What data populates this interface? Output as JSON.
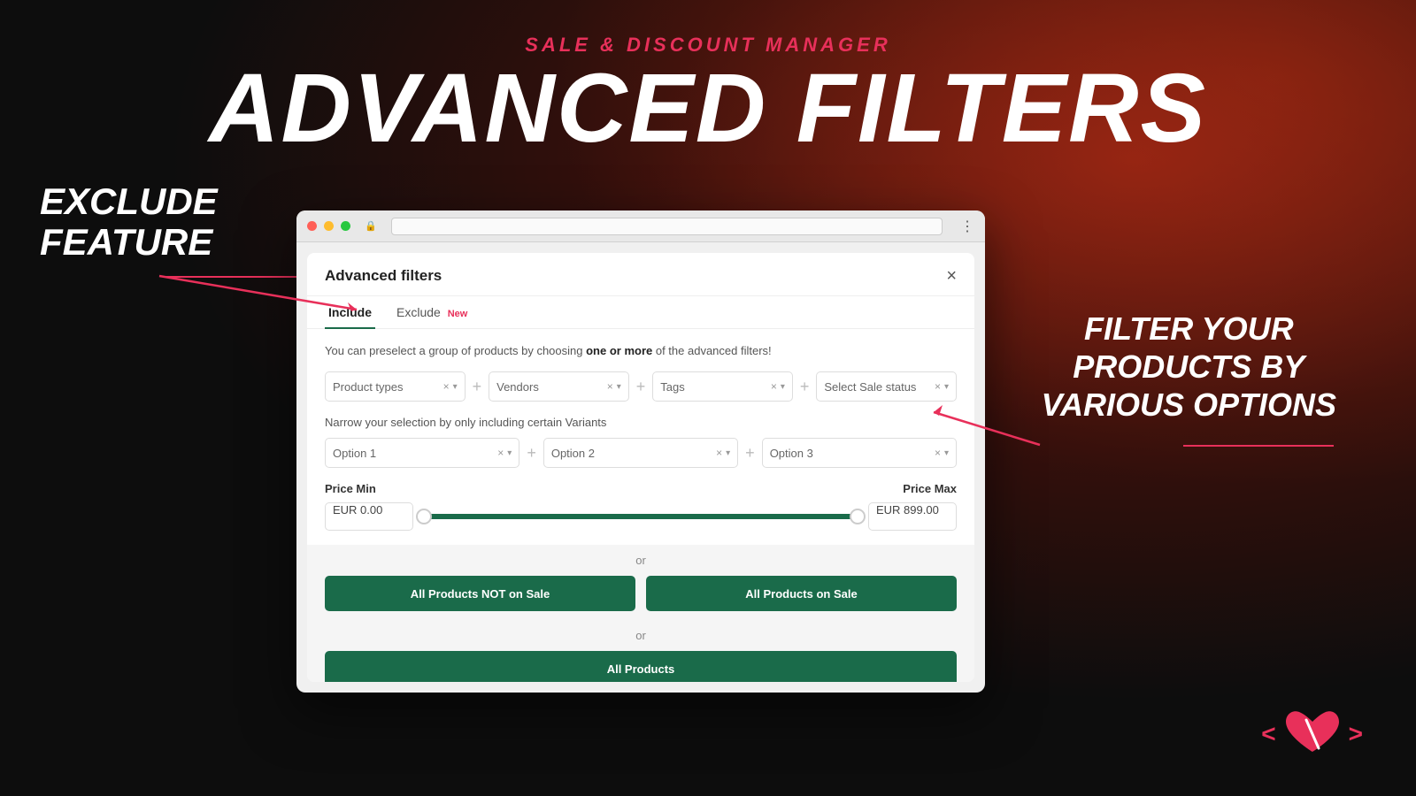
{
  "background": {
    "color": "#0d0d0d"
  },
  "header": {
    "subtitle": "SALE & DISCOUNT MANAGER",
    "main_title": "ADVANCED FILTERS"
  },
  "left_label": {
    "line1": "EXCLUDE",
    "line2": "FEATURE"
  },
  "right_label": {
    "line1": "FILTER YOUR",
    "line2": "PRODUCTS BY",
    "line3": "VARIOUS OPTIONS"
  },
  "browser": {
    "dots": [
      "red",
      "yellow",
      "green"
    ]
  },
  "modal": {
    "title": "Advanced filters",
    "close_label": "×",
    "tabs": [
      {
        "label": "Include",
        "active": true
      },
      {
        "label": "Exclude",
        "active": false,
        "badge": "New"
      }
    ],
    "description_start": "You can preselect a group of products by choosing ",
    "description_bold": "one or more",
    "description_end": " of the advanced filters!",
    "filter_selects": [
      {
        "placeholder": "Product types",
        "value": ""
      },
      {
        "placeholder": "Vendors",
        "value": ""
      },
      {
        "placeholder": "Tags",
        "value": ""
      },
      {
        "placeholder": "Select Sale status",
        "value": ""
      }
    ],
    "narrow_label": "Narrow your selection by only including certain Variants",
    "variant_selects": [
      {
        "placeholder": "Option 1",
        "value": ""
      },
      {
        "placeholder": "Option 2",
        "value": ""
      },
      {
        "placeholder": "Option 3",
        "value": ""
      }
    ],
    "price_min_label": "Price Min",
    "price_max_label": "Price Max",
    "price_min_value": "EUR 0.00",
    "price_max_value": "EUR 899.00",
    "or_label": "or",
    "buttons": [
      {
        "label": "All Products NOT on Sale"
      },
      {
        "label": "All Products on Sale"
      }
    ],
    "or_label2": "or",
    "all_products_label": "All Products"
  },
  "heart_logo": {
    "left_arrow": "<",
    "right_arrow": ">",
    "symbol": "♥/"
  }
}
